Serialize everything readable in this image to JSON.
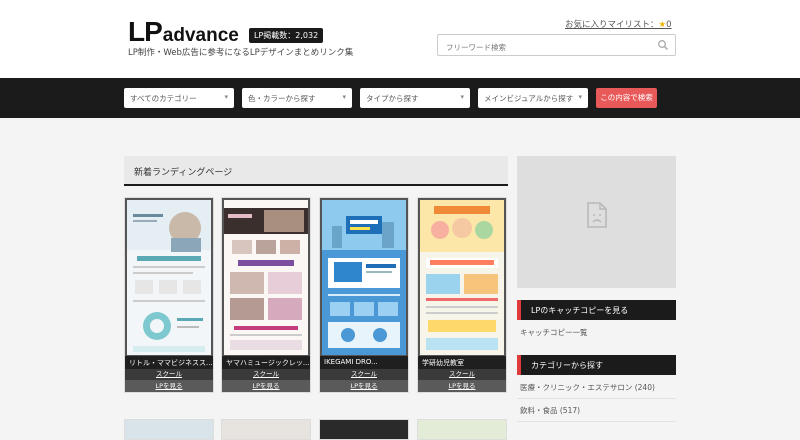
{
  "header": {
    "logo_lp": "LP",
    "logo_advance": "advance",
    "lp_count_badge": "LP掲載数：2,032",
    "tagline": "LP制作・Web広告に参考になるLPデザインまとめリンク集",
    "favorites_label": "お気に入りマイリスト：",
    "favorites_count": "0",
    "search_placeholder": "フリーワード検索"
  },
  "filters": {
    "category": "すべてのカテゴリー",
    "color": "色・カラーから探す",
    "type": "タイプから探す",
    "main_visual": "メインビジュアルから探す",
    "submit_label": "この内容で検索"
  },
  "main": {
    "section_title": "新着ランディングページ",
    "cards": [
      {
        "title": "リトル・ママビジネスス...",
        "category": "スクール",
        "link": "LPを見る"
      },
      {
        "title": "ヤマハミュージックレッ...",
        "category": "スクール",
        "link": "LPを見る"
      },
      {
        "title": "IKEGAMI DRO...",
        "category": "スクール",
        "link": "LPを見る"
      },
      {
        "title": "学研幼児教室",
        "category": "スクール",
        "link": "LPを見る"
      }
    ]
  },
  "sidebar": {
    "catchcopy_heading": "LPのキャッチコピーを見る",
    "catchcopy_link": "キャッチコピー一覧",
    "category_heading": "カテゴリーから探す",
    "category_items": [
      "医療・クリニック・エステサロン (240)",
      "飲料・食品 (517)"
    ]
  },
  "colors": {
    "accent_red": "#e85a5a",
    "dark_bar": "#1b1b1b",
    "star": "#f3b400"
  }
}
